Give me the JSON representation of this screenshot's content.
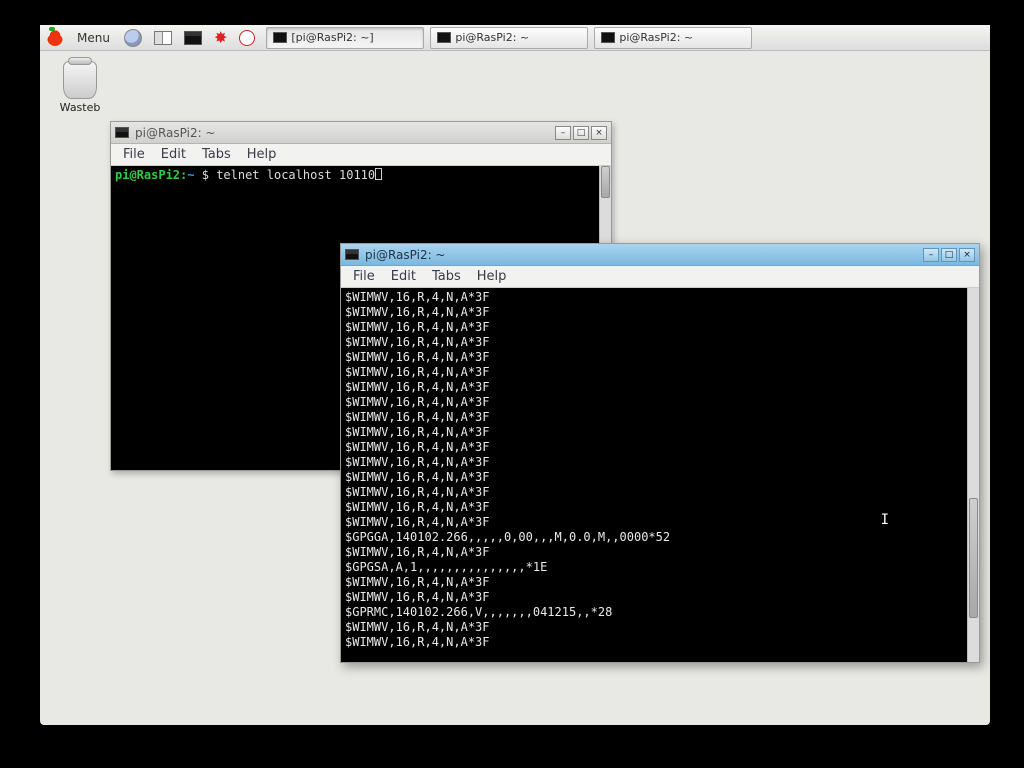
{
  "taskbar": {
    "menu_label": "Menu",
    "items": [
      {
        "label": "[pi@RasPi2: ~]"
      },
      {
        "label": "pi@RasPi2: ~"
      },
      {
        "label": "pi@RasPi2: ~"
      }
    ]
  },
  "desktop": {
    "wastebasket_label": "Wasteb"
  },
  "win1": {
    "title": "pi@RasPi2: ~",
    "menus": {
      "file": "File",
      "edit": "Edit",
      "tabs": "Tabs",
      "help": "Help"
    },
    "prompt_user": "pi@RasPi2:",
    "prompt_path": "~",
    "prompt_sign": "$",
    "command": "telnet localhost 10110"
  },
  "win2": {
    "title": "pi@RasPi2: ~",
    "menus": {
      "file": "File",
      "edit": "Edit",
      "tabs": "Tabs",
      "help": "Help"
    },
    "lines": [
      "$WIMWV,16,R,4,N,A*3F",
      "$WIMWV,16,R,4,N,A*3F",
      "$WIMWV,16,R,4,N,A*3F",
      "$WIMWV,16,R,4,N,A*3F",
      "$WIMWV,16,R,4,N,A*3F",
      "$WIMWV,16,R,4,N,A*3F",
      "$WIMWV,16,R,4,N,A*3F",
      "$WIMWV,16,R,4,N,A*3F",
      "$WIMWV,16,R,4,N,A*3F",
      "$WIMWV,16,R,4,N,A*3F",
      "$WIMWV,16,R,4,N,A*3F",
      "$WIMWV,16,R,4,N,A*3F",
      "$WIMWV,16,R,4,N,A*3F",
      "$WIMWV,16,R,4,N,A*3F",
      "$WIMWV,16,R,4,N,A*3F",
      "$WIMWV,16,R,4,N,A*3F",
      "$GPGGA,140102.266,,,,,0,00,,,M,0.0,M,,0000*52",
      "$WIMWV,16,R,4,N,A*3F",
      "$GPGSA,A,1,,,,,,,,,,,,,,,*1E",
      "$WIMWV,16,R,4,N,A*3F",
      "$WIMWV,16,R,4,N,A*3F",
      "$GPRMC,140102.266,V,,,,,,,041215,,*28",
      "$WIMWV,16,R,4,N,A*3F",
      "$WIMWV,16,R,4,N,A*3F"
    ],
    "text_cursor_glyph": "I"
  }
}
